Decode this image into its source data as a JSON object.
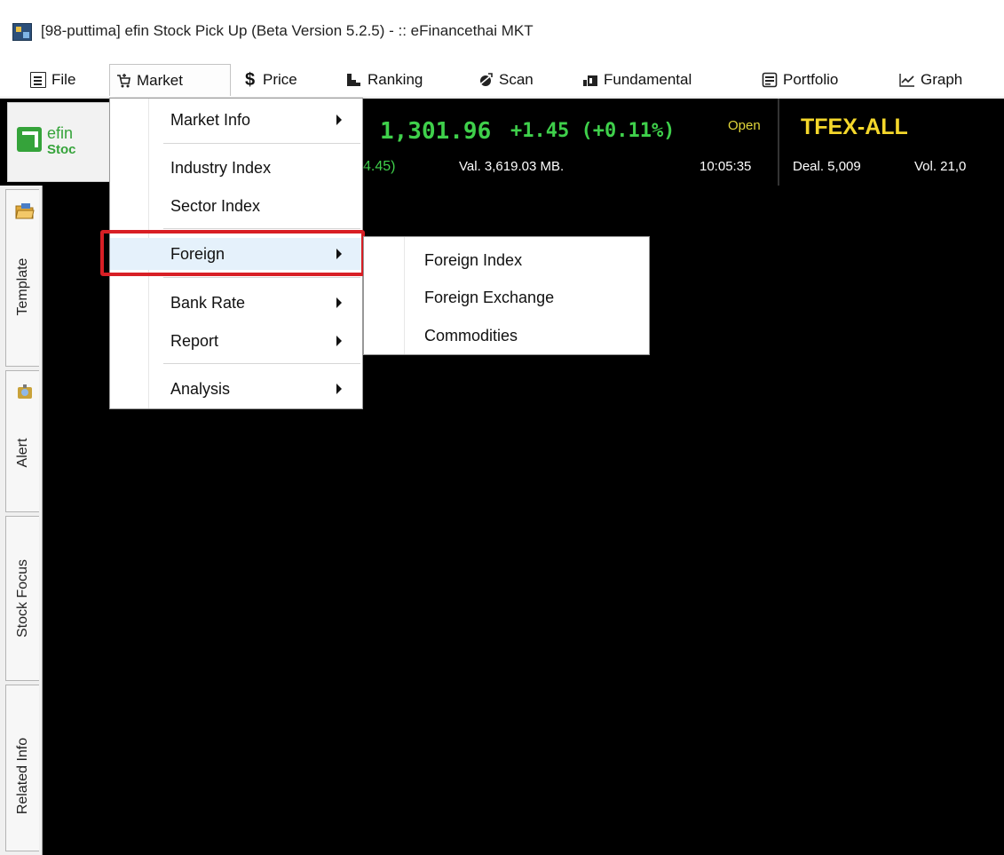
{
  "window": {
    "title": "[98-puttima] efin Stock Pick Up (Beta Version 5.2.5) - :: eFinancethai MKT"
  },
  "menubar": {
    "items": [
      {
        "label": "File",
        "icon": "file-icon"
      },
      {
        "label": "Market",
        "icon": "market-icon"
      },
      {
        "label": "Price",
        "icon": "dollar-icon"
      },
      {
        "label": "Ranking",
        "icon": "ranking-icon"
      },
      {
        "label": "Scan",
        "icon": "scan-icon"
      },
      {
        "label": "Fundamental",
        "icon": "fundamental-icon"
      },
      {
        "label": "Portfolio",
        "icon": "portfolio-icon"
      },
      {
        "label": "Graph",
        "icon": "graph-icon"
      }
    ]
  },
  "logo": {
    "line1": "efin",
    "line2": "Stoc"
  },
  "set_index": {
    "value": "1,301.96",
    "change": "+1.45 (+0.11%)",
    "status": "Open",
    "sub_change": "4.45)",
    "value_traded": "Val. 3,619.03 MB.",
    "time": "10:05:35"
  },
  "tfex": {
    "title": "TFEX-ALL",
    "deal": "Deal. 5,009",
    "vol": "Vol. 21,0"
  },
  "market_menu": {
    "items": [
      {
        "label": "Market Info",
        "submenu": true
      },
      {
        "label": "Industry Index",
        "submenu": false
      },
      {
        "label": "Sector Index",
        "submenu": false
      },
      {
        "label": "Foreign",
        "submenu": true
      },
      {
        "label": "Bank Rate",
        "submenu": true
      },
      {
        "label": "Report",
        "submenu": true
      },
      {
        "label": "Analysis",
        "submenu": true
      }
    ]
  },
  "foreign_submenu": {
    "items": [
      "Foreign Index",
      "Foreign Exchange",
      "Commodities"
    ]
  },
  "sidebar": {
    "tabs": [
      "Template",
      "Alert",
      "Stock Focus",
      "Related Info"
    ]
  },
  "colors": {
    "up_green": "#3fd04b",
    "tfex_yellow": "#f4d72b",
    "highlight_red": "#d81f25",
    "menu_highlight": "#e5f1fb"
  }
}
